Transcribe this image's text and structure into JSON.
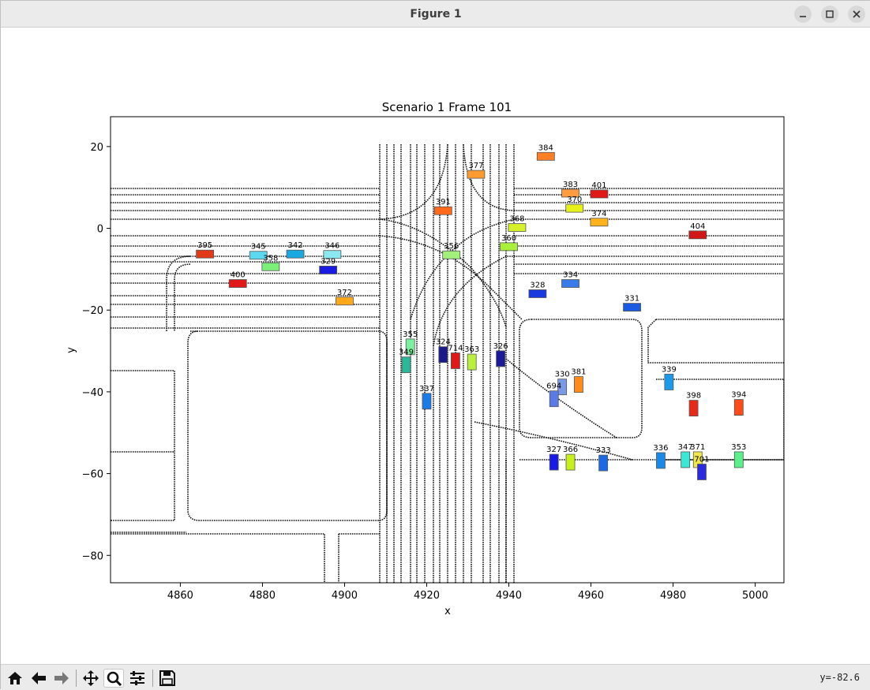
{
  "window": {
    "title": "Figure 1"
  },
  "toolbar": {
    "buttons": [
      "home-icon",
      "back-arrow-icon",
      "forward-arrow-icon",
      "pan-icon",
      "zoom-icon",
      "configure-subplots-icon",
      "save-icon"
    ],
    "coordinate_readout": "y=-82.6"
  },
  "chart_data": {
    "type": "scatter",
    "title": "Scenario 1 Frame 101",
    "xlabel": "x",
    "ylabel": "y",
    "xlim": [
      4843,
      5007
    ],
    "ylim": [
      -86.7,
      27.3
    ],
    "xticks": [
      4860,
      4880,
      4900,
      4920,
      4940,
      4960,
      4980,
      5000
    ],
    "yticks": [
      20,
      0,
      -20,
      -40,
      -60,
      -80
    ],
    "grid": false,
    "agents": [
      {
        "id": "384",
        "x": 4949,
        "y": 17.6,
        "color": "#ff7f27"
      },
      {
        "id": "377",
        "x": 4932,
        "y": 13.2,
        "color": "#ff9a2e"
      },
      {
        "id": "383",
        "x": 4955,
        "y": 8.6,
        "color": "#ff9c3d"
      },
      {
        "id": "401",
        "x": 4962,
        "y": 8.4,
        "color": "#e01818"
      },
      {
        "id": "370",
        "x": 4956,
        "y": 4.9,
        "color": "#e8f01a"
      },
      {
        "id": "391",
        "x": 4924,
        "y": 4.3,
        "color": "#ff6a1a"
      },
      {
        "id": "374",
        "x": 4962,
        "y": 1.5,
        "color": "#ffb21a"
      },
      {
        "id": "368",
        "x": 4942,
        "y": 0.2,
        "color": "#d6f02a"
      },
      {
        "id": "404",
        "x": 4986,
        "y": -1.6,
        "color": "#d01818"
      },
      {
        "id": "360",
        "x": 4940,
        "y": -4.5,
        "color": "#a8f03a"
      },
      {
        "id": "395",
        "x": 4866,
        "y": -6.3,
        "color": "#e03a18"
      },
      {
        "id": "345",
        "x": 4879,
        "y": -6.6,
        "color": "#5cd8f0"
      },
      {
        "id": "342",
        "x": 4888,
        "y": -6.3,
        "color": "#1aa8e0"
      },
      {
        "id": "346",
        "x": 4897,
        "y": -6.4,
        "color": "#8ae8f0"
      },
      {
        "id": "356",
        "x": 4926,
        "y": -6.5,
        "color": "#a0f07a"
      },
      {
        "id": "358",
        "x": 4882,
        "y": -9.4,
        "color": "#7af07a"
      },
      {
        "id": "329",
        "x": 4896,
        "y": -10.2,
        "color": "#1a1ae0"
      },
      {
        "id": "334",
        "x": 4955,
        "y": -13.5,
        "color": "#3a7ae8"
      },
      {
        "id": "400",
        "x": 4874,
        "y": -13.5,
        "color": "#e01818"
      },
      {
        "id": "328",
        "x": 4947,
        "y": -16,
        "color": "#1a3ae0"
      },
      {
        "id": "331",
        "x": 4970,
        "y": -19.3,
        "color": "#1a5ae0"
      },
      {
        "id": "372",
        "x": 4900,
        "y": -17.8,
        "color": "#ffa81a"
      },
      {
        "id": "355",
        "x": 4916,
        "y": -29,
        "color": "#7af0a0"
      },
      {
        "id": "324",
        "x": 4924,
        "y": -30.9,
        "color": "#1a1a8a"
      },
      {
        "id": "714",
        "x": 4927,
        "y": -32.4,
        "color": "#e01818"
      },
      {
        "id": "363",
        "x": 4931,
        "y": -32.7,
        "color": "#b8f03a"
      },
      {
        "id": "326",
        "x": 4938,
        "y": -31.9,
        "color": "#1a1a9a"
      },
      {
        "id": "349",
        "x": 4915,
        "y": -33.4,
        "color": "#2ab89a"
      },
      {
        "id": "339",
        "x": 4979,
        "y": -37.6,
        "color": "#1a9ae8"
      },
      {
        "id": "330",
        "x": 4953,
        "y": -38.8,
        "color": "#7a9ae8"
      },
      {
        "id": "381",
        "x": 4957,
        "y": -38.2,
        "color": "#ff8c1a"
      },
      {
        "id": "694",
        "x": 4951,
        "y": -41.7,
        "color": "#5a7ae8"
      },
      {
        "id": "337",
        "x": 4920,
        "y": -42.3,
        "color": "#1a7ae8"
      },
      {
        "id": "398",
        "x": 4985,
        "y": -44,
        "color": "#e82a18"
      },
      {
        "id": "394",
        "x": 4996,
        "y": -43.8,
        "color": "#ff4a1a"
      },
      {
        "id": "327",
        "x": 4951,
        "y": -57.2,
        "color": "#1a1ae8"
      },
      {
        "id": "366",
        "x": 4955,
        "y": -57.2,
        "color": "#c8f01a"
      },
      {
        "id": "333",
        "x": 4963,
        "y": -57.4,
        "color": "#1a6ae8"
      },
      {
        "id": "336",
        "x": 4977,
        "y": -56.8,
        "color": "#1a8ae8"
      },
      {
        "id": "347",
        "x": 4983,
        "y": -56.6,
        "color": "#3ae8d8"
      },
      {
        "id": "371",
        "x": 4986,
        "y": -56.6,
        "color": "#f0e84a"
      },
      {
        "id": "353",
        "x": 4996,
        "y": -56.6,
        "color": "#5af08a"
      },
      {
        "id": "701",
        "x": 4987,
        "y": -59.6,
        "color": "#2a2ae0"
      }
    ]
  }
}
